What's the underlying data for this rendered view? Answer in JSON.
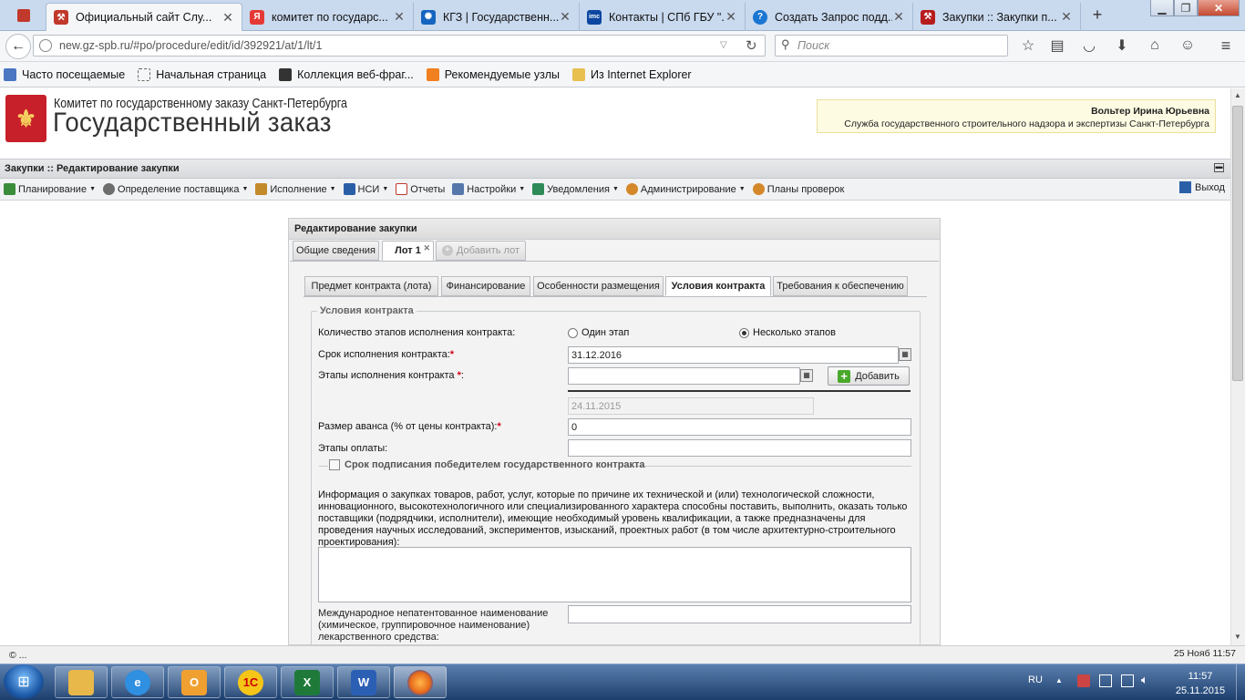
{
  "browser": {
    "tabs": [
      {
        "label": "Официальный сайт Слу...",
        "icon": "gear-favicon",
        "color": "#c0392b"
      },
      {
        "label": "комитет по государс...",
        "icon": "yandex-favicon",
        "color": "#e53935"
      },
      {
        "label": "КГЗ | Государственн...",
        "icon": "kgz-favicon",
        "color": "#1565c0"
      },
      {
        "label": "Контакты | СПб ГБУ \"...",
        "icon": "imc-favicon",
        "color": "#0d47a1"
      },
      {
        "label": "Создать Запрос подд...",
        "icon": "help-favicon",
        "color": "#1976d2"
      },
      {
        "label": "Закупки :: Закупки п...",
        "icon": "gavel-favicon",
        "color": "#b71c1c"
      }
    ],
    "url": "new.gz-spb.ru/#po/procedure/edit/id/392921/at/1/lt/1",
    "url_host": "new.gz-spb.ru",
    "search_placeholder": "Поиск",
    "bookmarks": [
      {
        "label": "Часто посещаемые"
      },
      {
        "label": "Начальная страница"
      },
      {
        "label": "Коллекция веб-фраг..."
      },
      {
        "label": "Рекомендуемые узлы"
      },
      {
        "label": "Из Internet Explorer"
      }
    ]
  },
  "header": {
    "org_line1": "Комитет по государственному заказу Санкт-Петербурга",
    "org_line2": "Государственный заказ",
    "user_name": "Вольтер Ирина Юрьевна",
    "user_org": "Служба государственного строительного надзора и экспертизы Санкт-Петербурга"
  },
  "breadcrumb": "Закупки :: Редактирование закупки",
  "menu": [
    {
      "label": "Планирование",
      "icon": "planning-icon",
      "caret": true,
      "color": "#3a8d3a"
    },
    {
      "label": "Определение поставщика",
      "icon": "supplier-icon",
      "caret": true,
      "color": "#6d6d6d"
    },
    {
      "label": "Исполнение",
      "icon": "execution-icon",
      "caret": true,
      "color": "#c28a2a"
    },
    {
      "label": "НСИ",
      "icon": "book-icon",
      "caret": true,
      "color": "#2a5fa8"
    },
    {
      "label": "Отчеты",
      "icon": "report-icon",
      "caret": false,
      "color": "#c0392b"
    },
    {
      "label": "Настройки",
      "icon": "wrench-icon",
      "caret": true,
      "color": "#5577aa"
    },
    {
      "label": "Уведомления",
      "icon": "notification-icon",
      "caret": true,
      "color": "#2e8b57"
    },
    {
      "label": "Администрирование",
      "icon": "user-admin-icon",
      "caret": true,
      "color": "#d4882a"
    },
    {
      "label": "Планы проверок",
      "icon": "user-plan-icon",
      "caret": false,
      "color": "#d4882a"
    }
  ],
  "exit_label": "Выход",
  "panel": {
    "title": "Редактирование закупки",
    "tabs": [
      {
        "label": "Общие сведения"
      },
      {
        "label": "Лот 1"
      },
      {
        "label": "Добавить лот"
      }
    ],
    "subtabs": [
      {
        "label": "Предмет контракта (лота)"
      },
      {
        "label": "Финансирование"
      },
      {
        "label": "Особенности размещения"
      },
      {
        "label": "Условия контракта"
      },
      {
        "label": "Требования к обеспечению"
      }
    ]
  },
  "form": {
    "legend": "Условия контракта",
    "stages_label": "Количество этапов исполнения контракта:",
    "radio_one": "Один этап",
    "radio_many": "Несколько этапов",
    "term_label": "Срок исполнения контракта:",
    "term_value": "31.12.2016",
    "stages_exec_label": "Этапы исполнения контракта",
    "add_button": "Добавить",
    "stage_date_value": "24.11.2015",
    "advance_label": "Размер аванса (% от цены контракта):",
    "advance_value": "0",
    "payment_label": "Этапы оплаты:",
    "payment_value": "",
    "signing_label": "Срок подписания победителем государственного контракта",
    "info_text": "Информация о закупках товаров, работ, услуг, которые по причине их технической и (или) технологической сложности, инновационного, высокотехнологичного или специализированного характера способны поставить, выполнить, оказать только поставщики (подрядчики, исполнители), имеющие необходимый уровень квалификации, а также предназначены для проведения научных исследований, экспериментов, изысканий, проектных работ (в том числе архитектурно-строительного проектирования):",
    "mnn_label": "Международное непатентованное наименование (химическое, группировочное наименование) лекарственного средства:"
  },
  "status": {
    "left": "© ...",
    "right": "25 Нояб 11:57"
  },
  "taskbar": {
    "apps": [
      {
        "name": "explorer",
        "icon": "folder-icon",
        "color": "#e8b84a"
      },
      {
        "name": "ie",
        "icon": "ie-icon",
        "color": "#2f8fe0"
      },
      {
        "name": "outlook",
        "icon": "outlook-icon",
        "color": "#f0a030"
      },
      {
        "name": "1c",
        "icon": "1c-icon",
        "color": "#f5c518"
      },
      {
        "name": "excel",
        "icon": "excel-icon",
        "color": "#1f7a3a"
      },
      {
        "name": "word",
        "icon": "word-icon",
        "color": "#2b5fb4"
      },
      {
        "name": "firefox",
        "icon": "firefox-icon",
        "color": "#e86a1a"
      }
    ],
    "lang": "RU",
    "time": "11:57",
    "date": "25.11.2015"
  }
}
